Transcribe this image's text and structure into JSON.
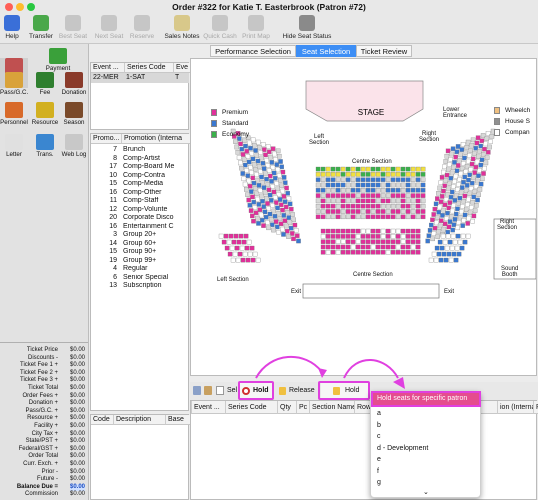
{
  "window_title": "Order #322 for Katie T. Easterbrook (Patron #72)",
  "toolbar": [
    {
      "label": "Help",
      "icon": "help-icon",
      "enabled": true,
      "color": "#3a6fd8"
    },
    {
      "label": "Transfer",
      "icon": "transfer-icon",
      "enabled": true,
      "color": "#4aa84a"
    },
    {
      "label": "Best Seat",
      "icon": "best-seat-icon",
      "enabled": false,
      "color": "#c6c6c6"
    },
    {
      "label": "Next Seat",
      "icon": "next-seat-icon",
      "enabled": false,
      "color": "#c6c6c6"
    },
    {
      "label": "Reserve",
      "icon": "reserve-icon",
      "enabled": false,
      "color": "#c6c6c6"
    },
    {
      "label": "Sales Notes",
      "icon": "sales-notes-icon",
      "enabled": true,
      "color": "#d8c88a"
    },
    {
      "label": "Quick Cash",
      "icon": "quick-cash-icon",
      "enabled": false,
      "color": "#c6c6c6"
    },
    {
      "label": "Print Map",
      "icon": "print-map-icon",
      "enabled": false,
      "color": "#c6c6c6"
    },
    {
      "label": "Hide Seat Status",
      "icon": "hide-seat-status-icon",
      "enabled": true,
      "color": "#8a8a8a"
    }
  ],
  "tabs": [
    {
      "label": "Performance Selection",
      "active": false
    },
    {
      "label": "Seat Selection",
      "active": true
    },
    {
      "label": "Ticket Review",
      "active": false
    }
  ],
  "left_buttons": [
    {
      "label": "Ticket",
      "icon": "ticket-icon",
      "color": "#c05050"
    },
    {
      "label": "Payment",
      "icon": "payment-icon",
      "color": "#3aa03a"
    },
    {
      "label": "Pass/G.C.",
      "icon": "pass-gc-icon",
      "color": "#d9a23a"
    },
    {
      "label": "Fee",
      "icon": "fee-icon",
      "color": "#2f7f2f"
    },
    {
      "label": "Donation",
      "icon": "donation-icon",
      "color": "#8a3a2a"
    },
    {
      "label": "Personnel",
      "icon": "personnel-icon",
      "color": "#d86a2a"
    },
    {
      "label": "Resource",
      "icon": "resource-icon",
      "color": "#d2b020"
    },
    {
      "label": "Season",
      "icon": "season-icon",
      "color": "#7a4a2a"
    },
    {
      "label": "Letter",
      "icon": "letter-icon",
      "color": "#e0e0e0"
    },
    {
      "label": "Trans.",
      "icon": "trans-icon",
      "color": "#3a86d0"
    },
    {
      "label": "Web Log",
      "icon": "web-log-icon",
      "color": "#c8c8c8"
    }
  ],
  "totals": [
    {
      "label": "Ticket Price",
      "value": "$0.00"
    },
    {
      "label": "Discounts -",
      "value": "$0.00"
    },
    {
      "label": "Ticket Fee 1 +",
      "value": "$0.00"
    },
    {
      "label": "Ticket Fee 2 +",
      "value": "$0.00"
    },
    {
      "label": "Ticket Fee 3 +",
      "value": "$0.00"
    },
    {
      "label": "Ticket Total",
      "value": "$0.00"
    },
    {
      "label": "Order Fees +",
      "value": "$0.00"
    },
    {
      "label": "Donation +",
      "value": "$0.00"
    },
    {
      "label": "Pass/G.C. +",
      "value": "$0.00"
    },
    {
      "label": "Resource +",
      "value": "$0.00"
    },
    {
      "label": "Facility +",
      "value": "$0.00"
    },
    {
      "label": "City Tax +",
      "value": "$0.00"
    },
    {
      "label": "State/PST +",
      "value": "$0.00"
    },
    {
      "label": "Federal/GST +",
      "value": "$0.00"
    },
    {
      "label": "Order Total",
      "value": "$0.00"
    },
    {
      "label": "Curr. Exch. +",
      "value": "$0.00"
    },
    {
      "label": "Prior -",
      "value": "$0.00"
    },
    {
      "label": "Future -",
      "value": "$0.00"
    },
    {
      "label": "Balance Due =",
      "value": "$0.00"
    },
    {
      "label": "Commission",
      "value": "$0.00"
    }
  ],
  "events_grid": {
    "headers": [
      "Event ...",
      "Series Code",
      "Eve"
    ],
    "rows": [
      [
        "22-MER",
        "1-SAT",
        "T"
      ]
    ]
  },
  "promo_grid": {
    "headers": [
      "Promo...",
      "Promotion (Interna"
    ],
    "rows": [
      [
        "7",
        "Brunch"
      ],
      [
        "8",
        "Comp-Artist"
      ],
      [
        "17",
        "Comp-Board Me"
      ],
      [
        "10",
        "Comp-Contra"
      ],
      [
        "15",
        "Comp-Media"
      ],
      [
        "16",
        "Comp-Other"
      ],
      [
        "11",
        "Comp-Staff"
      ],
      [
        "12",
        "Comp-Volunte"
      ],
      [
        "20",
        "Corporate Disco"
      ],
      [
        "16",
        "Entertainment C"
      ],
      [
        "3",
        "Group 20+"
      ],
      [
        "14",
        "Group 60+"
      ],
      [
        "15",
        "Group 90+"
      ],
      [
        "19",
        "Group 99+"
      ],
      [
        "4",
        "Regular"
      ],
      [
        "6",
        "Senior Special"
      ],
      [
        "13",
        "Subscription"
      ]
    ]
  },
  "code_grid": {
    "headers": [
      "Code",
      "Description",
      "Base"
    ]
  },
  "seat_grid": {
    "headers": [
      "Event ...",
      "Series Code",
      "Qty",
      "Pc",
      "Section Name",
      "Row",
      "",
      "ion (Internal)",
      "Prei"
    ]
  },
  "seatmap": {
    "stage": "STAGE",
    "legend": [
      {
        "label": "Premium",
        "color": "#e0309a"
      },
      {
        "label": "Standard",
        "color": "#3a78d0"
      },
      {
        "label": "Economy",
        "color": "#3ab04a"
      }
    ],
    "legend_right": [
      {
        "label": "Wheelch",
        "color": "#f0c080"
      },
      {
        "label": "House S",
        "color": "#909090"
      },
      {
        "label": "Compan",
        "color": "#ffffff"
      }
    ],
    "labels": {
      "left_section_top": "Left\nSection",
      "lower_entrance": "Lower\nEntrance",
      "right_section_top": "Right\nSection",
      "centre_section": "Centre Section",
      "centre_section_bottom": "Centre Section",
      "left_section_bottom": "Left Section",
      "right_section_bottom": "Right\nSection",
      "sound_booth": "Sound\nBooth",
      "exit_left": "Exit",
      "exit_right": "Exit"
    }
  },
  "midbar": {
    "sel_label": "Sel",
    "hold_label": "Hold",
    "release_label": "Release",
    "hold2_label": "Hold"
  },
  "dropdown": {
    "title": "Hold seats for specific patron",
    "items": [
      "a",
      "b",
      "c",
      "d - Development",
      "e",
      "f",
      "g"
    ],
    "accent": "#e040e0"
  }
}
